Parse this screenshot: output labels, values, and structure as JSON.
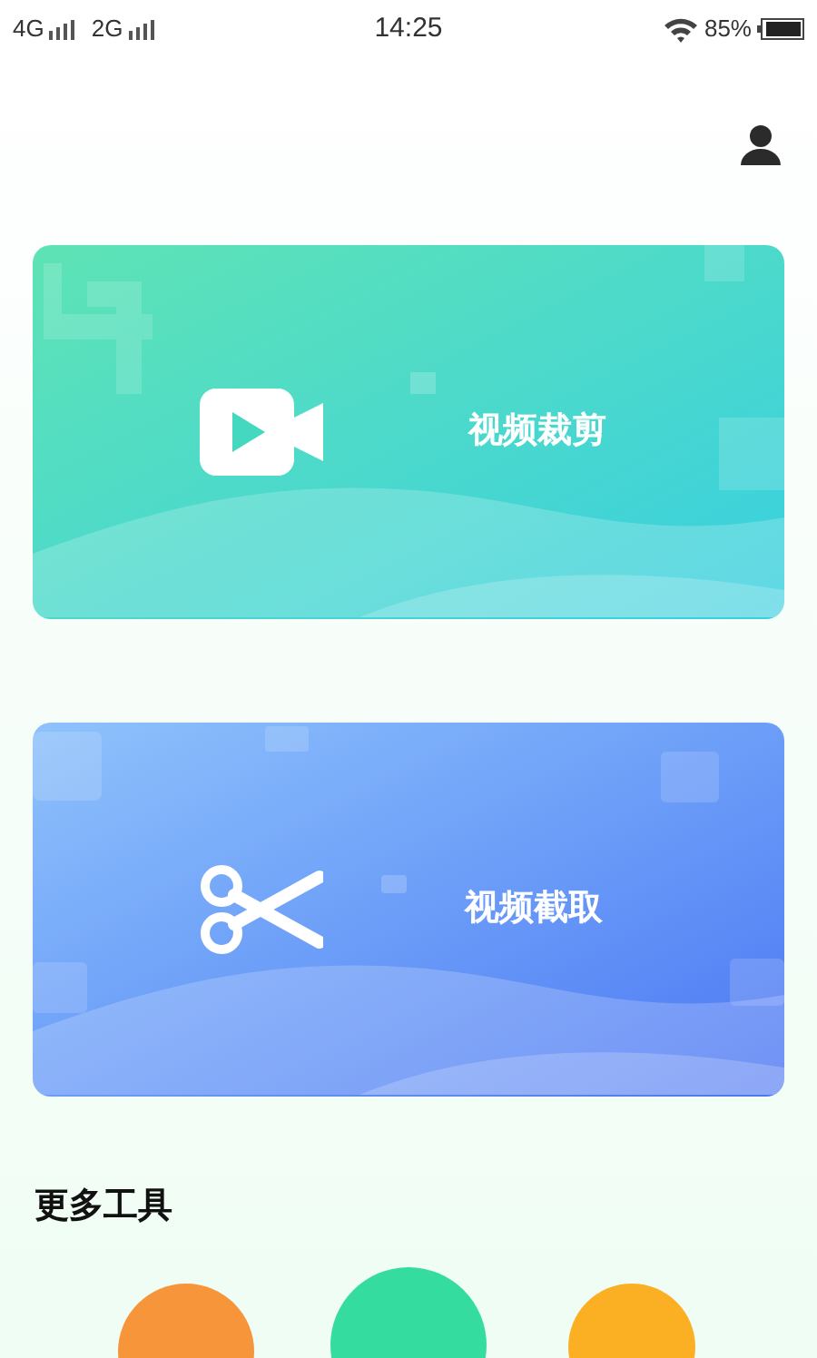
{
  "status_bar": {
    "network_1": "4G",
    "network_2": "2G",
    "time": "14:25",
    "battery": "85%"
  },
  "cards": [
    {
      "kind": "crop",
      "label": "视频裁剪"
    },
    {
      "kind": "capture",
      "label": "视频截取"
    }
  ],
  "section_title": "更多工具",
  "tools": [
    {
      "color": "#f7953a"
    },
    {
      "color": "#34dca0"
    },
    {
      "color": "#fbb024"
    }
  ]
}
